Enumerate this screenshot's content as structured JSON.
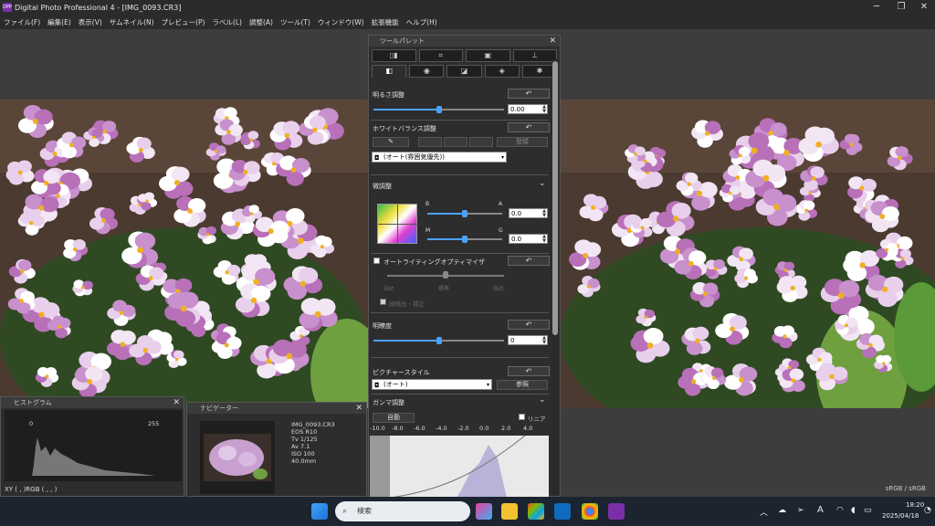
{
  "window": {
    "title": "Digital Photo Professional 4 - [IMG_0093.CR3]",
    "logo_text": "DPP",
    "controls": {
      "minimize": "─",
      "maximize": "❐",
      "close": "✕"
    }
  },
  "menu": [
    "ファイル(F)",
    "編集(E)",
    "表示(V)",
    "サムネイル(N)",
    "プレビュー(P)",
    "ラベル(L)",
    "調整(A)",
    "ツール(T)",
    "ウィンドウ(W)",
    "拡張機能",
    "ヘルプ(H)"
  ],
  "tool_palette": {
    "title": "ツールパレット",
    "top_tabs": [
      "▯▮",
      "⌗",
      "▣",
      "⊥"
    ],
    "bottom_tabs": [
      "◧",
      "◉",
      "◪",
      "◈",
      "✱"
    ],
    "brightness": {
      "label": "明るさ調整",
      "value": "0.00",
      "position": 0.5
    },
    "white_balance": {
      "label": "ホワイトバランス調整",
      "button_register": "登録",
      "preset": "(オート(雰囲気優先))"
    },
    "fine_tune": {
      "label": "微調整",
      "label_b": "B",
      "label_a": "A",
      "label_m": "M",
      "label_g": "G",
      "ba_value": "0.0",
      "mg_value": "0.0",
      "ba_position": 0.5,
      "mg_position": 0.5
    },
    "alo": {
      "label": "オートライティングオプティマイザ",
      "levels": [
        "弱め",
        "標準",
        "強め"
      ],
      "face_detect": "顔検出・補正",
      "position": 0.5
    },
    "clarity": {
      "label": "明瞭度",
      "value": "0",
      "position": 0.5
    },
    "picture_style": {
      "label": "ピクチャースタイル",
      "preset": "(オート)",
      "browse": "参照"
    },
    "gamma": {
      "label": "ガンマ調整",
      "auto": "自動",
      "linear": "リニア",
      "ticks": [
        "-10.0",
        "-8.0",
        "-6.0",
        "-4.0",
        "-2.0",
        "0.0",
        "2.0",
        "4.0"
      ]
    },
    "reset_icon": "↶"
  },
  "histogram": {
    "title": "ヒストグラム",
    "min": "0",
    "max": "255",
    "readout": "XY (    ,    )RGB (    ,    ,    )"
  },
  "navigator": {
    "title": "ナビゲーター",
    "info": [
      "IMG_0093.CR3",
      "EOS R10",
      "Tv 1/125",
      "Av 7.1",
      "ISO 100",
      "40.0mm"
    ]
  },
  "status": {
    "color_space": "sRGB / sRGB"
  },
  "taskbar": {
    "search_placeholder": "検索",
    "time": "18:20",
    "date": "2025/04/18",
    "ime": "A"
  }
}
